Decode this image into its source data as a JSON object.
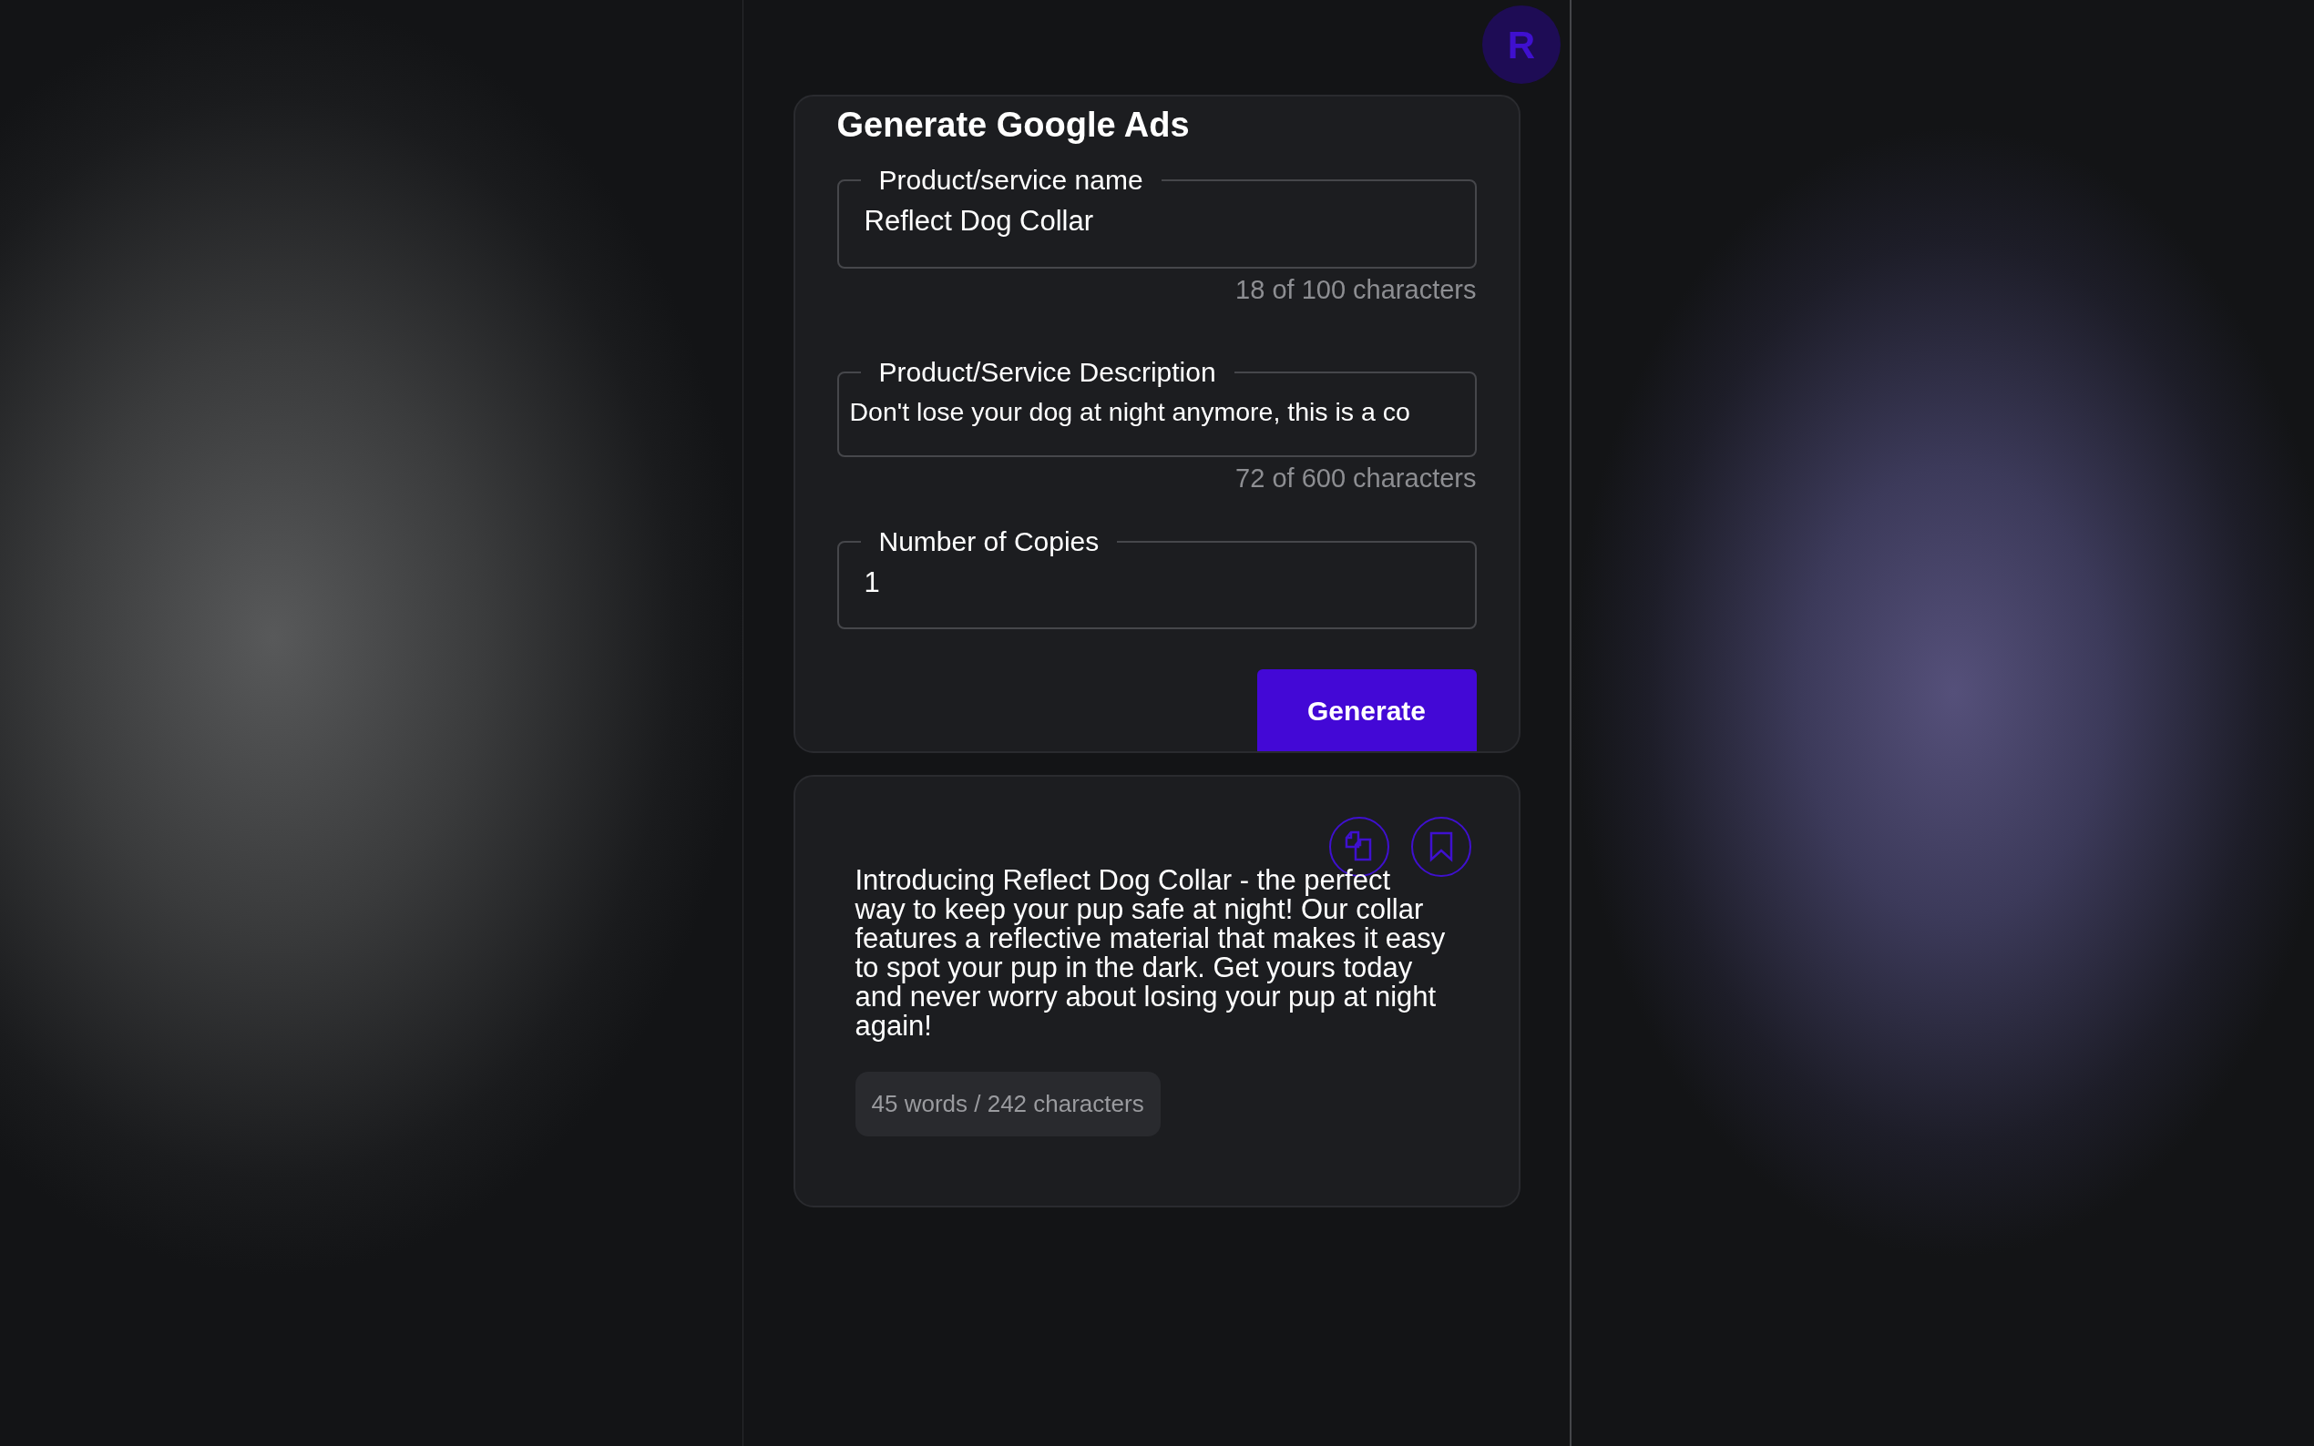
{
  "header": {
    "avatar": "R"
  },
  "form": {
    "title": "Generate Google Ads",
    "submit": "Generate",
    "fields": [
      {
        "label": "Product/service name",
        "value": "Reflect Dog Collar",
        "counter": "18 of 100 characters"
      },
      {
        "label": "Product/Service Description",
        "value": "Don't lose your dog at night anymore, this is a co",
        "counter": "72 of 600 characters"
      },
      {
        "label": "Number of Copies",
        "value": "1"
      }
    ]
  },
  "results": [
    {
      "text": "Introducing Reflect Dog Collar - the perfect way to keep your pup safe at night! Our collar features a reflective material that makes it easy to spot your pup in the dark. Get yours today and never worry about losing your pup at night again!",
      "stats": "45 words / 242 characters"
    }
  ]
}
